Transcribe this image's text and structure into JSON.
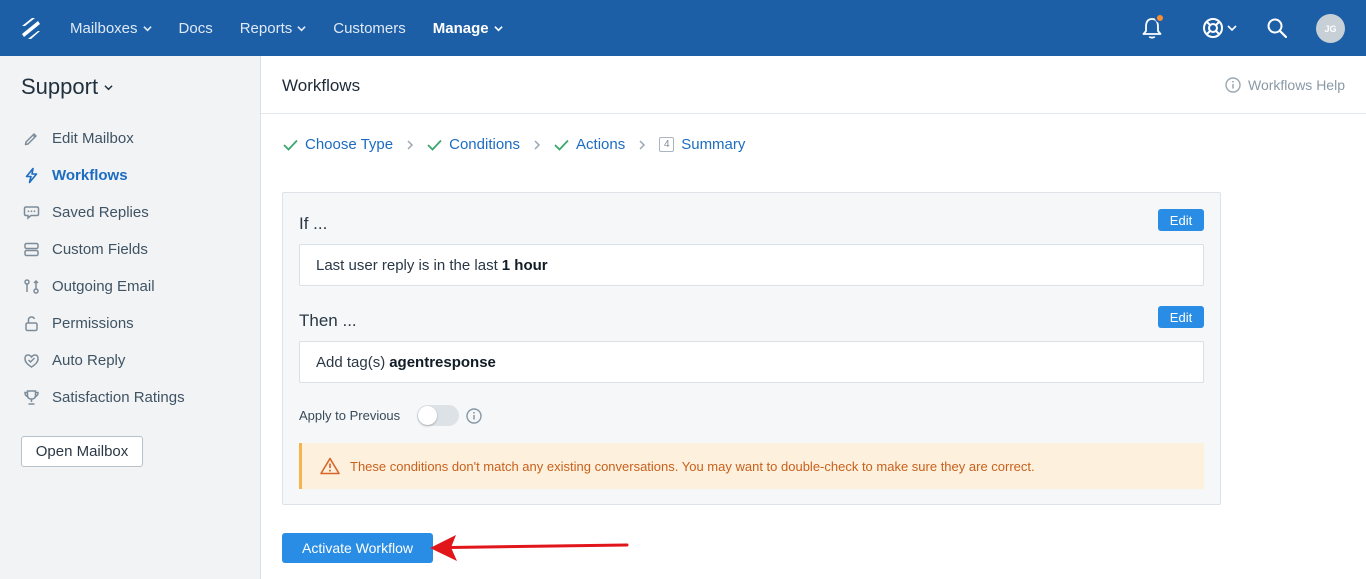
{
  "topnav": {
    "items": [
      {
        "label": "Mailboxes",
        "has_caret": true,
        "active": false
      },
      {
        "label": "Docs",
        "has_caret": false,
        "active": false
      },
      {
        "label": "Reports",
        "has_caret": true,
        "active": false
      },
      {
        "label": "Customers",
        "has_caret": false,
        "active": false
      },
      {
        "label": "Manage",
        "has_caret": true,
        "active": true
      }
    ],
    "avatar_initials": "JG",
    "icons": [
      "logo-icon",
      "bell-icon",
      "lifebuoy-icon",
      "search-icon"
    ],
    "colors": {
      "bar": "#1d5fa7",
      "notification_dot": "#ff8c2f"
    }
  },
  "sidebar": {
    "mailbox_name": "Support",
    "items": [
      {
        "label": "Edit Mailbox",
        "icon": "pencil-icon",
        "active": false
      },
      {
        "label": "Workflows",
        "icon": "lightning-icon",
        "active": true
      },
      {
        "label": "Saved Replies",
        "icon": "speech-bubble-icon",
        "active": false
      },
      {
        "label": "Custom Fields",
        "icon": "fields-icon",
        "active": false
      },
      {
        "label": "Outgoing Email",
        "icon": "outgoing-email-icon",
        "active": false
      },
      {
        "label": "Permissions",
        "icon": "lock-icon",
        "active": false
      },
      {
        "label": "Auto Reply",
        "icon": "auto-reply-icon",
        "active": false
      },
      {
        "label": "Satisfaction Ratings",
        "icon": "trophy-icon",
        "active": false
      }
    ],
    "open_mailbox_label": "Open Mailbox"
  },
  "header": {
    "title": "Workflows",
    "help_label": "Workflows Help"
  },
  "steps": [
    {
      "label": "Choose Type",
      "state": "done"
    },
    {
      "label": "Conditions",
      "state": "done"
    },
    {
      "label": "Actions",
      "state": "done"
    },
    {
      "label": "Summary",
      "state": "current",
      "number": "4"
    }
  ],
  "summary": {
    "if_label": "If ...",
    "then_label": "Then ...",
    "edit_label": "Edit",
    "condition_text": "Last user reply is in the last",
    "condition_value": "1 hour",
    "action_text": "Add tag(s)",
    "action_value": "agentresponse",
    "apply_previous_label": "Apply to Previous",
    "apply_previous_on": false,
    "warning_text": "These conditions don't match any existing conversations. You may want to double-check to make sure they are correct."
  },
  "activate_label": "Activate Workflow",
  "colors": {
    "accent": "#2a8de5",
    "link": "#1d6cc2",
    "check": "#3aa76d",
    "warning_bg": "#fdf0dc",
    "warning_text": "#c7611e",
    "annotation_arrow": "#e0161b"
  }
}
